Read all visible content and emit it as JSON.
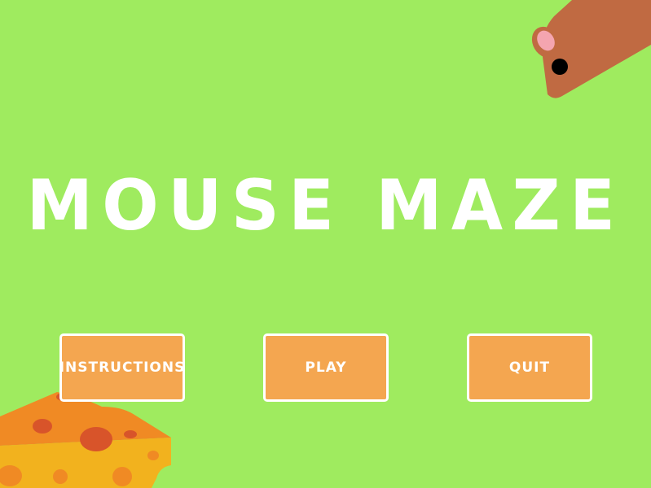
{
  "game": {
    "title": "MOUSE MAZE"
  },
  "menu": {
    "instructions_label": "INSTRUCTIONS",
    "play_label": "PLAY",
    "quit_label": "QUIT"
  },
  "colors": {
    "background": "#9feb5f",
    "button_fill": "#f4a650",
    "button_border": "#ffffff",
    "text": "#ffffff",
    "mouse_body": "#c06a42",
    "mouse_ear": "#f4a5b0",
    "cheese_top": "#f08a24",
    "cheese_side": "#f2b21e"
  },
  "icons": {
    "mouse": "mouse-icon",
    "cheese": "cheese-icon"
  }
}
